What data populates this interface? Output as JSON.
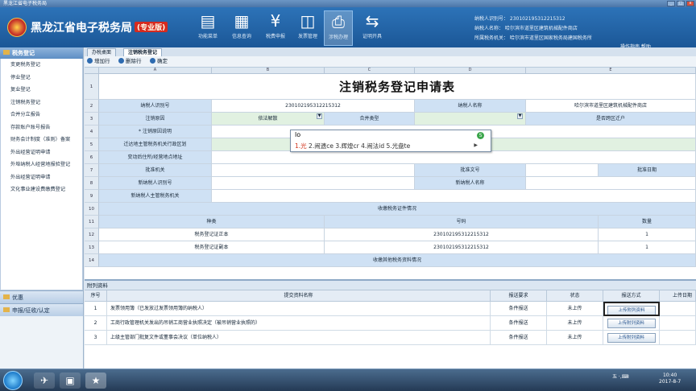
{
  "window": {
    "title": "黑龙江省电子税务局"
  },
  "header": {
    "bureau_name": "黑龙江省电子税务局",
    "badge": "(专业版)",
    "nav": [
      {
        "label": "功能菜单",
        "icon": "form-icon"
      },
      {
        "label": "信息查询",
        "icon": "building-icon"
      },
      {
        "label": "税费申报",
        "icon": "yen-icon"
      },
      {
        "label": "发票管理",
        "icon": "invoice-icon"
      },
      {
        "label": "涉税办理",
        "icon": "printer-icon"
      },
      {
        "label": "证明开具",
        "icon": "swap-icon"
      }
    ],
    "info_lines": [
      "纳税人识别号：   230102195312215312",
      "纳税人名称：   哈尔滨市道里区建筑机械配件商店",
      "所属税务机关：   哈尔滨市道里区国家税务局建国税务所"
    ],
    "ops": "操作指南  帮助"
  },
  "sidebar": {
    "head": "税务登记",
    "items": [
      "变更税务登记",
      "停业登记",
      "复业登记",
      "注销税务登记",
      "合并分立报告",
      "存款账户账号报告",
      "财务会计制度（准则）备案",
      "外出经营证明申请",
      "外埠纳税人经营地报验登记",
      "外出经营证明申请",
      "文化事业建设费缴费登记"
    ],
    "sections": [
      "优惠",
      "申报/征收/认定"
    ]
  },
  "tabs": [
    "办税桌面",
    "注销税务登记"
  ],
  "toolbar": {
    "add": "增加行",
    "del": "删除行",
    "ok": "确定"
  },
  "sheet": {
    "col_heads": [
      "A",
      "B",
      "C",
      "D",
      "E"
    ],
    "rows": [
      "1",
      "2",
      "3",
      "4",
      "5",
      "6",
      "7",
      "8",
      "9",
      "10",
      "11",
      "12",
      "13",
      "14"
    ],
    "title": "注销税务登记申请表",
    "r2": {
      "a": "纳税人识别号",
      "b": "230102195312215312",
      "c": "纳税人名称",
      "d": "哈尔滨市道里区建筑机械配件商店"
    },
    "r3": {
      "a": "注销原因",
      "b": "依法解散",
      "c": "合并类型",
      "d": "",
      "e": "是否跨区迁户"
    },
    "r4": {
      "a": "* 注销原因说明"
    },
    "r5": {
      "a": "迁达地主管税务机关行政区划"
    },
    "r6": {
      "a": "变动后住所/经营地点地址"
    },
    "r7": {
      "a": "批准机关",
      "c": "批准文号",
      "e": "批准日期"
    },
    "r8": {
      "a": "新纳税人识别号",
      "c": "新纳税人名称"
    },
    "r9": {
      "a": "新纳税人主管税务机关"
    },
    "r10": "收缴税务证件情况",
    "r11": {
      "a": "种类",
      "b": "号码",
      "c": "数量"
    },
    "r12": {
      "a": "税务登记证正本",
      "b": "230102195312215312",
      "c": "1"
    },
    "r13": {
      "a": "税务登记证副本",
      "b": "230102195312215312",
      "c": "1"
    },
    "r14": "收缴其他税务资料情况"
  },
  "ime": {
    "typed": "lo",
    "candidates": [
      "1.光",
      "2.闹遗ce",
      "3.辉煌cr",
      "4.闹法id",
      "5.光盘te"
    ]
  },
  "attachments": {
    "title": "附列资料",
    "headers": [
      "序号",
      "提交资料名称",
      "报送要求",
      "状态",
      "报送方式",
      "上传日期"
    ],
    "rows": [
      {
        "no": "1",
        "name": "发票领用簿（已发放过发票领用簿的纳税人）",
        "req": "条件报送",
        "status": "未上传",
        "btn": "上传附列资料"
      },
      {
        "no": "2",
        "name": "工商行政管理机关发出的吊销工商营业执照决定（被吊销营业执照的）",
        "req": "条件报送",
        "status": "未上传",
        "btn": "上传附列资料"
      },
      {
        "no": "3",
        "name": "上级主管部门批复文件或董事会决议（单位纳税人）",
        "req": "条件报送",
        "status": "未上传",
        "btn": "上传附列资料"
      }
    ]
  },
  "taskbar": {
    "tray": "五 ·,⌨",
    "time": "10:40",
    "date": "2017-8-7"
  }
}
